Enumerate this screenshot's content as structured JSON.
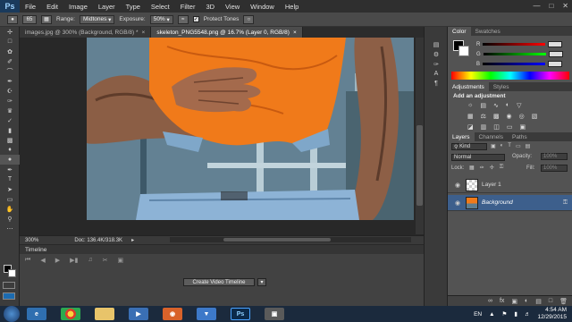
{
  "app": {
    "logo": "Ps",
    "menu": [
      "File",
      "Edit",
      "Image",
      "Layer",
      "Type",
      "Select",
      "Filter",
      "3D",
      "View",
      "Window",
      "Help"
    ]
  },
  "options": {
    "brush_size": "65",
    "range_label": "Range:",
    "range_value": "Midtones",
    "exposure_label": "Exposure:",
    "exposure_value": "50%",
    "protect_tones": "Protect Tones"
  },
  "tabs": [
    {
      "label": "images.jpg @ 300% (Background, RGB/8) *"
    },
    {
      "label": "skeleton_PNG5548.png @ 16.7% (Layer 0, RGB/8)"
    }
  ],
  "status": {
    "zoom": "300%",
    "doc": "Doc: 136.4K/318.3K"
  },
  "timeline": {
    "header": "Timeline",
    "create_button": "Create Video Timeline"
  },
  "color_panel": {
    "tabs": [
      "Color",
      "Swatches"
    ],
    "channels": [
      "R",
      "G",
      "B"
    ]
  },
  "adjustments": {
    "tabs": [
      "Adjustments",
      "Styles"
    ],
    "heading": "Add an adjustment"
  },
  "layers_panel": {
    "tabs": [
      "Layers",
      "Channels",
      "Paths"
    ],
    "kind": "Kind",
    "blend_mode": "Normal",
    "opacity_label": "Opacity:",
    "opacity_value": "100%",
    "lock_label": "Lock:",
    "fill_label": "Fill:",
    "fill_value": "100%",
    "layers": [
      {
        "name": "Layer 1"
      },
      {
        "name": "Background"
      }
    ]
  },
  "taskbar": {
    "lang": "EN",
    "time": "4:54 AM",
    "date": "12/29/2015"
  },
  "colors": {
    "accent_blue": "#1c6bb0",
    "shirt_orange": "#f07a1a",
    "background_layer_highlight": "#3d5f8c"
  }
}
